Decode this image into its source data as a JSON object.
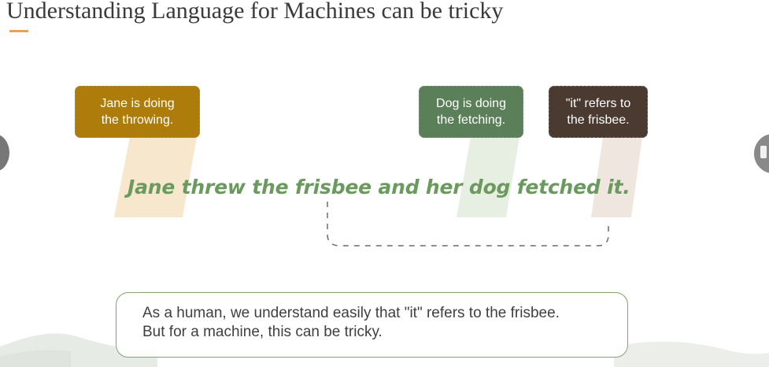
{
  "slide": {
    "title": "Understanding Language for Machines can be tricky"
  },
  "callouts": {
    "jane": {
      "line1": "Jane is doing",
      "line2": "the throwing."
    },
    "dog": {
      "line1": "Dog is doing",
      "line2": "the fetching."
    },
    "it": {
      "line1": "\"it\" refers to",
      "line2": "the frisbee."
    }
  },
  "sentence": "Jane threw the frisbee and her dog fetched it.",
  "note": {
    "line1": "As a human, we understand easily that \"it\" refers to the frisbee.",
    "line2": "But for a machine, this can be tricky."
  },
  "colors": {
    "accent_orange": "#e8a254",
    "jane_callout": "#ad7c0a",
    "dog_callout": "#5b7f58",
    "it_callout": "#4a3a30",
    "sentence_green": "#6a9a5e",
    "note_border": "#7ea66f"
  },
  "icons": {
    "nav_previous": "previous-slide-icon",
    "nav_next": "next-slide-icon"
  }
}
